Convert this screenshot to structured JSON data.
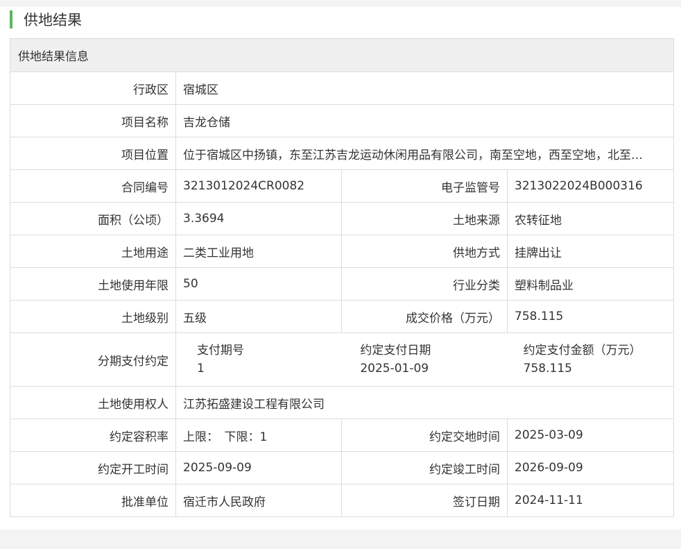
{
  "section_title": "供地结果",
  "table_header": "供地结果信息",
  "rows": {
    "district_label": "行政区",
    "district": "宿城区",
    "project_name_label": "项目名称",
    "project_name": "吉龙仓储",
    "location_label": "项目位置",
    "location": "位于宿城区中扬镇，东至江苏吉龙运动休闲用品有限公司，南至空地，西至空地，北至…",
    "contract_no_label": "合同编号",
    "contract_no": "3213012024CR0082",
    "supervision_no_label": "电子监管号",
    "supervision_no": "3213022024B000316",
    "area_label": "面积（公顷）",
    "area": "3.3694",
    "land_source_label": "土地来源",
    "land_source": "农转征地",
    "land_use_label": "土地用途",
    "land_use": "二类工业用地",
    "supply_method_label": "供地方式",
    "supply_method": "挂牌出让",
    "term_label": "土地使用年限",
    "term": "50",
    "industry_label": "行业分类",
    "industry": "塑料制品业",
    "grade_label": "土地级别",
    "grade": "五级",
    "price_label": "成交价格（万元）",
    "price": "758.115",
    "installment_label": "分期支付约定",
    "installment": {
      "col1_header": "支付期号",
      "col1_value": "1",
      "col2_header": "约定支付日期",
      "col2_value": "2025-01-09",
      "col3_header": "约定支付金额（万元）",
      "col3_value": "758.115"
    },
    "user_label": "土地使用权人",
    "user": "江苏拓盛建设工程有限公司",
    "far_label": "约定容积率",
    "far": "上限：　下限：1",
    "handover_label": "约定交地时间",
    "handover": "2025-03-09",
    "start_label": "约定开工时间",
    "start": "2025-09-09",
    "complete_label": "约定竣工时间",
    "complete": "2026-09-09",
    "approver_label": "批准单位",
    "approver": "宿迁市人民政府",
    "sign_date_label": "签订日期",
    "sign_date": "2024-11-11"
  },
  "colors": {
    "accent": "#5cb85c",
    "header_bg": "#f0f0f0",
    "border": "#dcdcdc"
  }
}
